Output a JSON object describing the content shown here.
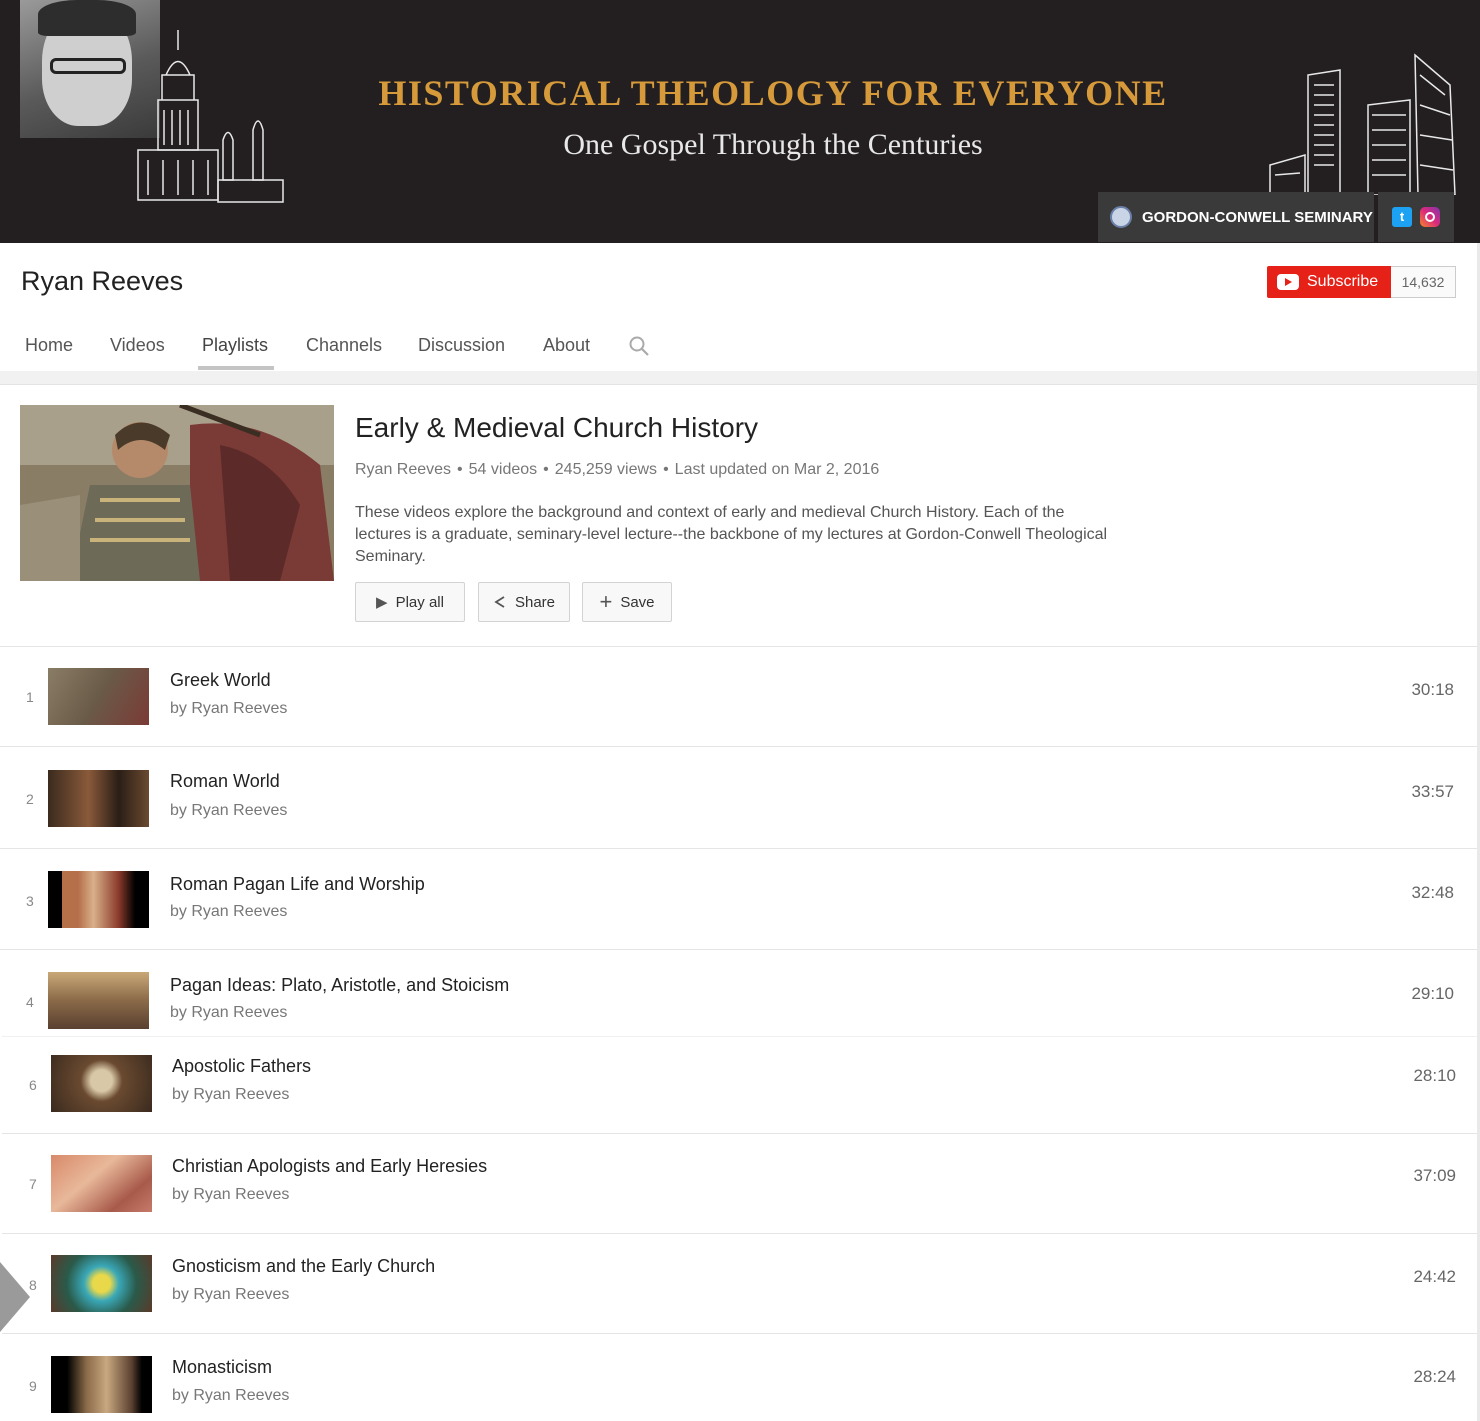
{
  "banner": {
    "title": "HISTORICAL THEOLOGY FOR EVERYONE",
    "subtitle": "One Gospel Through the Centuries",
    "link_label": "GORDON-CONWELL SEMINARY",
    "icons": [
      "seminary-seal-icon",
      "twitter-icon",
      "instagram-icon"
    ]
  },
  "channel": {
    "name": "Ryan Reeves",
    "subscribe_label": "Subscribe",
    "subscriber_count": "14,632"
  },
  "tabs": [
    {
      "label": "Home"
    },
    {
      "label": "Videos"
    },
    {
      "label": "Playlists",
      "active": true
    },
    {
      "label": "Channels"
    },
    {
      "label": "Discussion"
    },
    {
      "label": "About"
    }
  ],
  "playlist": {
    "title": "Early & Medieval Church History",
    "author": "Ryan Reeves",
    "video_count": "54 videos",
    "views": "245,259 views",
    "updated": "Last updated on Mar 2, 2016",
    "description": "These videos explore the background and context of early and medieval Church History. Each of the lectures is a graduate, seminary-level lecture--the backbone of my lectures at Gordon-Conwell Theological Seminary.",
    "buttons": {
      "play_all": "Play all",
      "share": "Share",
      "save": "Save"
    }
  },
  "videos": [
    {
      "index": "1",
      "title": "Greek World",
      "byline": "by Ryan Reeves",
      "duration": "30:18"
    },
    {
      "index": "2",
      "title": "Roman World",
      "byline": "by Ryan Reeves",
      "duration": "33:57"
    },
    {
      "index": "3",
      "title": "Roman Pagan Life and Worship",
      "byline": "by Ryan Reeves",
      "duration": "32:48"
    },
    {
      "index": "4",
      "title": "Pagan Ideas: Plato, Aristotle, and Stoicism",
      "byline": "by Ryan Reeves",
      "duration": "29:10"
    },
    {
      "index": "6",
      "title": "Apostolic Fathers",
      "byline": "by Ryan Reeves",
      "duration": "28:10"
    },
    {
      "index": "7",
      "title": "Christian Apologists and Early Heresies",
      "byline": "by Ryan Reeves",
      "duration": "37:09"
    },
    {
      "index": "8",
      "title": "Gnosticism and the Early Church",
      "byline": "by Ryan Reeves",
      "duration": "24:42"
    },
    {
      "index": "9",
      "title": "Monasticism",
      "byline": "by Ryan Reeves",
      "duration": "28:24"
    }
  ],
  "colors": {
    "banner_bg": "#231f20",
    "title_gold": "#d69a3a",
    "subscribe_red": "#e62117"
  }
}
